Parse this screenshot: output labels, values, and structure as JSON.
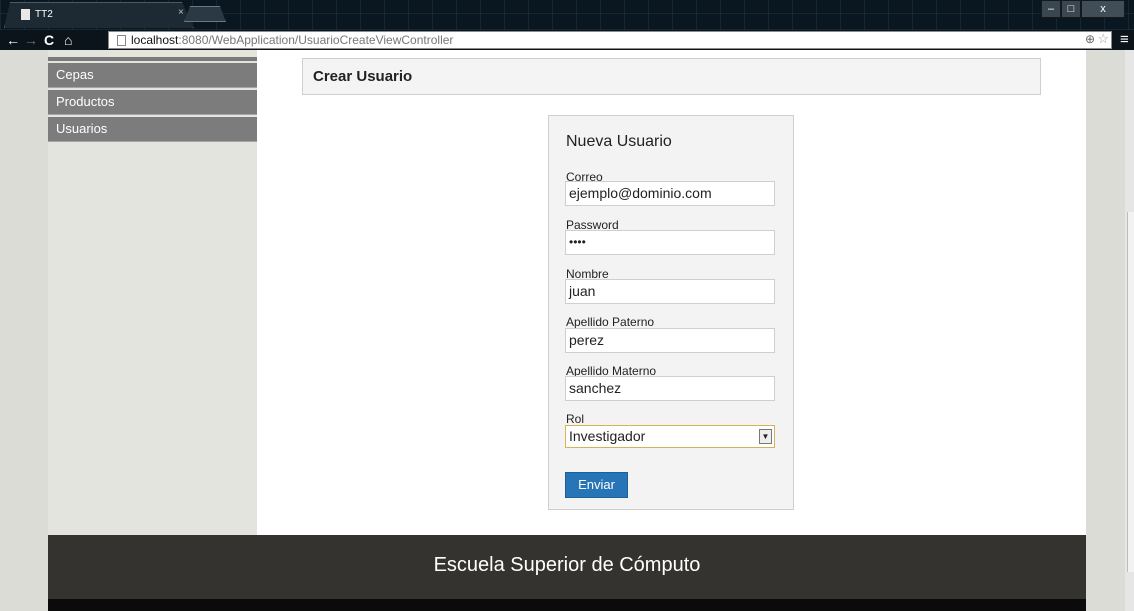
{
  "browser": {
    "tab_title": "TT2",
    "tab_close": "×",
    "url_host": "localhost",
    "url_rest": ":8080/WebApplication/UsuarioCreateViewController",
    "window_min": "–",
    "window_max": "□",
    "window_close": "x",
    "nav_back": "←",
    "nav_forward": "→",
    "nav_reload": "C",
    "nav_home": "⌂",
    "zoom_icon": "zoom-icon",
    "star_icon": "star-icon",
    "menu_glyph": "≡"
  },
  "sidebar": {
    "items": [
      {
        "label": "Cepas"
      },
      {
        "label": "Productos"
      },
      {
        "label": "Usuarios"
      }
    ]
  },
  "header": {
    "title": "Crear Usuario"
  },
  "form": {
    "title": "Nueva Usuario",
    "fields": [
      {
        "label": "Correo",
        "value": "ejemplo@dominio.com"
      },
      {
        "label": "Password",
        "value": "••••"
      },
      {
        "label": "Nombre",
        "value": "juan"
      },
      {
        "label": "Apellido Paterno",
        "value": "perez"
      },
      {
        "label": "Apellido Materno",
        "value": "sanchez"
      }
    ],
    "rol": {
      "label": "Rol",
      "selected": "Investigador"
    },
    "submit_label": "Enviar"
  },
  "footer": {
    "text": "Escuela Superior de Cómputo"
  },
  "colors": {
    "accent": "#2775b6",
    "sidebar_item": "#7c7c7c",
    "footer": "#343330"
  }
}
